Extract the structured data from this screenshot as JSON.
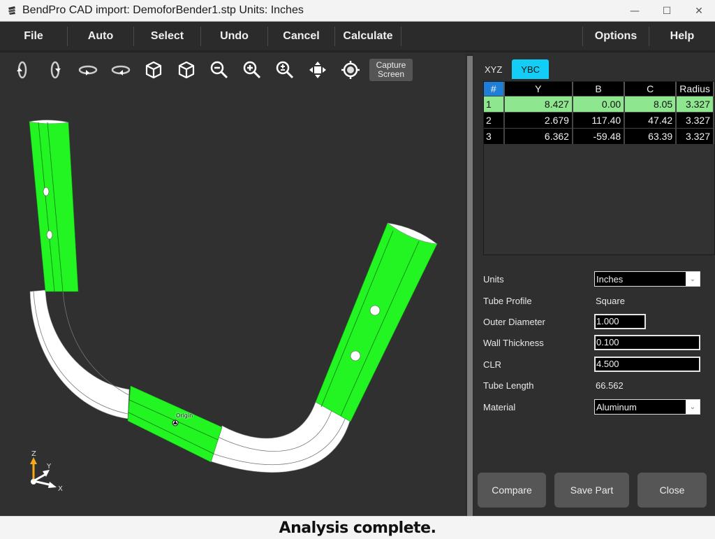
{
  "window": {
    "title": "BendPro CAD import: DemoforBender1.stp  Units: Inches",
    "controls": {
      "minimize": "—",
      "maximize": "☐",
      "close": "✕"
    }
  },
  "menu": {
    "items": [
      "File",
      "Auto",
      "Select",
      "Undo",
      "Cancel",
      "Calculate"
    ],
    "right_items": [
      "Options",
      "Help"
    ]
  },
  "toolbar": {
    "icons": [
      "rotate-left-icon",
      "rotate-right-icon",
      "spin-left-icon",
      "spin-right-icon",
      "view-cube-left-icon",
      "view-cube-right-icon",
      "zoom-out-icon",
      "zoom-in-icon",
      "zoom-fit-icon",
      "pan-icon",
      "center-target-icon"
    ],
    "capture_line1": "Capture",
    "capture_line2": "Screen"
  },
  "viewport": {
    "origin_label": "Origin",
    "axis_labels": {
      "x": "X",
      "y": "Y",
      "z": "Z"
    },
    "colors": {
      "straight": "#22f522",
      "bend": "#ffffff",
      "background": "#303030",
      "z_axis": "#f7a81b"
    }
  },
  "panel": {
    "tabs": [
      {
        "label": "XYZ",
        "active": false
      },
      {
        "label": "YBC",
        "active": true
      }
    ],
    "table": {
      "headers": [
        "#",
        "Y",
        "B",
        "C",
        "Radius"
      ],
      "rows": [
        {
          "n": "1",
          "y": "8.427",
          "b": "0.00",
          "c": "8.05",
          "r": "3.327",
          "selected": true
        },
        {
          "n": "2",
          "y": "2.679",
          "b": "117.40",
          "c": "47.42",
          "r": "3.327",
          "selected": false
        },
        {
          "n": "3",
          "y": "6.362",
          "b": "-59.48",
          "c": "63.39",
          "r": "3.327",
          "selected": false
        }
      ]
    },
    "properties": {
      "units": {
        "label": "Units",
        "value": "Inches"
      },
      "tube_profile": {
        "label": "Tube Profile",
        "value": "Square"
      },
      "outer_diameter": {
        "label": "Outer Diameter",
        "value": "1.000"
      },
      "wall_thickness": {
        "label": "Wall Thickness",
        "value": "0.100"
      },
      "clr": {
        "label": "CLR",
        "value": "4.500"
      },
      "tube_length": {
        "label": "Tube Length",
        "value": "66.562"
      },
      "material": {
        "label": "Material",
        "value": "Aluminum"
      }
    },
    "buttons": {
      "compare": "Compare",
      "save_part": "Save Part",
      "close": "Close"
    }
  },
  "status": {
    "text": "Analysis complete."
  }
}
